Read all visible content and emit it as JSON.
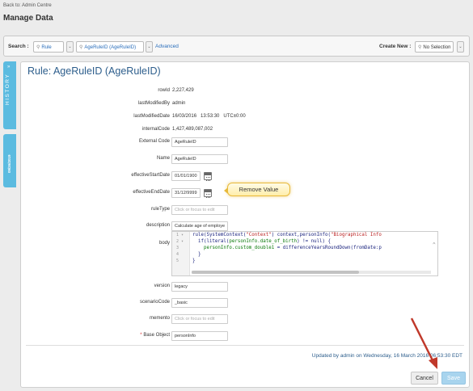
{
  "nav": {
    "back_link": "Back to: Admin Centre",
    "page_title": "Manage Data"
  },
  "search": {
    "label": "Search :",
    "type_value": "Rule",
    "object_value": "AgeRuleID (AgeRuleID)",
    "advanced_link": "Advanced",
    "create_new_label": "Create New :",
    "create_new_value": "No Selection"
  },
  "side_tabs": {
    "history": "HISTORY",
    "history_arrow": "»",
    "version": "09/26/2019"
  },
  "record": {
    "title": "Rule: AgeRuleID (AgeRuleID)",
    "fields": {
      "rowid": {
        "label": "rowId",
        "value": "2,227,429"
      },
      "last_modified_by": {
        "label": "lastModifiedBy",
        "value": "admin"
      },
      "last_modified_date": {
        "label": "lastModifiedDate",
        "value": "16/03/2016   13:53:30   UTC±0:00"
      },
      "internal_code": {
        "label": "internalCode",
        "value": "1,427,489,087,002"
      },
      "external_code": {
        "label": "External Code",
        "value": "AgeRuleID"
      },
      "name": {
        "label": "Name",
        "value": "AgeRuleID"
      },
      "effective_start_date": {
        "label": "effectiveStartDate",
        "value": "01/01/1900"
      },
      "effective_end_date": {
        "label": "effectiveEndDate",
        "value": "31/12/9999"
      },
      "rule_type": {
        "label": "ruleType",
        "placeholder": "Click or focus to edit"
      },
      "description": {
        "label": "description",
        "value": "Calculate age of employe"
      },
      "body": {
        "label": "body"
      },
      "version": {
        "label": "version",
        "value": "legacy"
      },
      "scenario_code": {
        "label": "scenarioCode",
        "value": "_basic"
      },
      "memento": {
        "label": "memento",
        "placeholder": "Click or focus to edit"
      },
      "base_object": {
        "required_mark": "*",
        "label": "Base Object",
        "value": "personInfo"
      }
    },
    "tooltip": "Remove Value",
    "code": {
      "line_numbers": [
        "1 ▾",
        "2 ▾",
        "3",
        "4",
        "5"
      ],
      "lines": [
        {
          "a": "rule(SystemContext(",
          "s": "\"Context\"",
          "b": ") context,personInfo(",
          "s2": "\"Biographical Info"
        },
        {
          "a": "  if(literal(",
          "g": "personInfo.date_of_birth",
          "b": ") != null) {"
        },
        {
          "a": "    ",
          "g": "personInfo.custom_double1",
          "b": " = differenceYearsRoundDown(fromDate:p"
        },
        {
          "a": "  }"
        },
        {
          "a": "}"
        }
      ]
    },
    "updated_text": "Updated by admin on Wednesday, 16 March 2016 06:53:30 EDT",
    "cancel_label": "Cancel",
    "save_label": "Save"
  },
  "colors": {
    "accent": "#5bbbe0",
    "title": "#2d5e8c",
    "link": "#2a6ebb",
    "arrow": "#c0392b"
  }
}
